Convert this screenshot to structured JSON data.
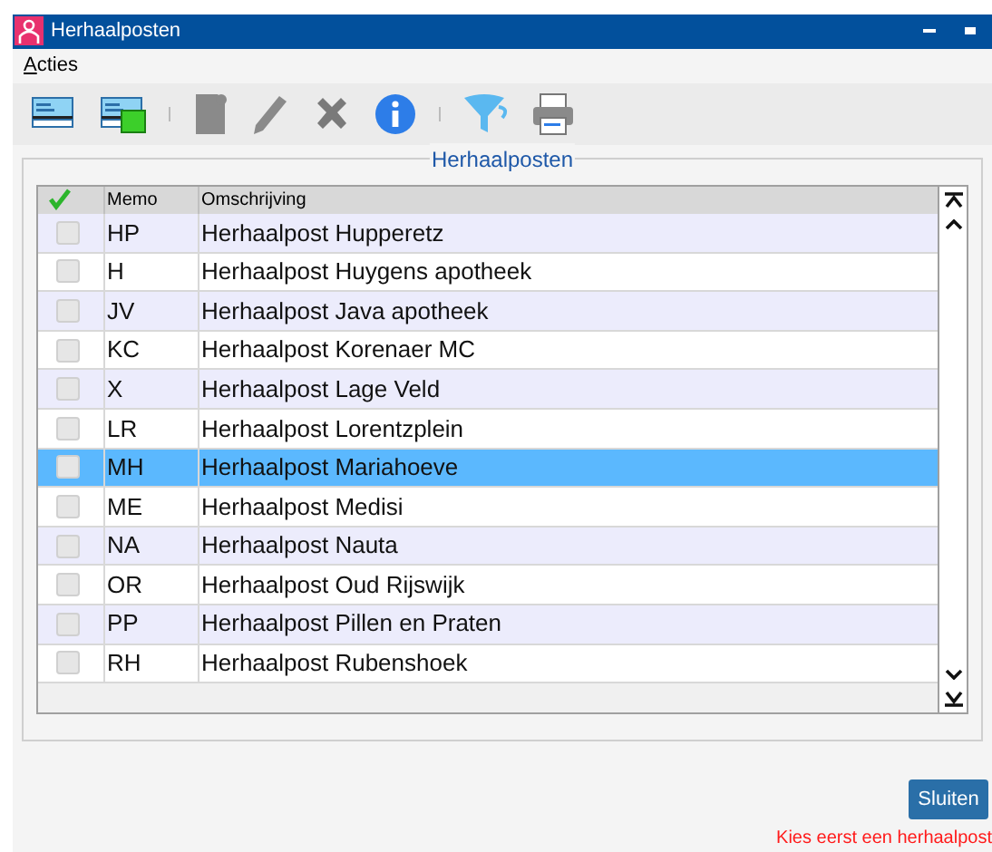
{
  "window": {
    "title": "Herhaalposten"
  },
  "menu": [
    {
      "label": "Acties"
    }
  ],
  "group": {
    "title": "Herhaalposten"
  },
  "table": {
    "columns": [
      "Memo",
      "Omschrijving"
    ],
    "rows": [
      {
        "memo": "HP",
        "description": "Herhaalpost Hupperetz",
        "checked": false,
        "selected": false
      },
      {
        "memo": "H",
        "description": "Herhaalpost Huygens apotheek",
        "checked": false,
        "selected": false
      },
      {
        "memo": "JV",
        "description": "Herhaalpost Java apotheek",
        "checked": false,
        "selected": false
      },
      {
        "memo": "KC",
        "description": "Herhaalpost Korenaer MC",
        "checked": false,
        "selected": false
      },
      {
        "memo": "X",
        "description": "Herhaalpost Lage Veld",
        "checked": false,
        "selected": false
      },
      {
        "memo": "LR",
        "description": "Herhaalpost Lorentzplein",
        "checked": false,
        "selected": false
      },
      {
        "memo": "MH",
        "description": "Herhaalpost Mariahoeve",
        "checked": false,
        "selected": true
      },
      {
        "memo": "ME",
        "description": "Herhaalpost Medisi",
        "checked": false,
        "selected": false
      },
      {
        "memo": "NA",
        "description": "Herhaalpost Nauta",
        "checked": false,
        "selected": false
      },
      {
        "memo": "OR",
        "description": "Herhaalpost Oud Rijswijk",
        "checked": false,
        "selected": false
      },
      {
        "memo": "PP",
        "description": "Herhaalpost Pillen en Praten",
        "checked": false,
        "selected": false
      },
      {
        "memo": "RH",
        "description": "Herhaalpost Rubenshoek",
        "checked": false,
        "selected": false
      }
    ]
  },
  "buttons": [
    {
      "label": "Sluiten"
    }
  ],
  "error": "Kies eerst een herhaalpost"
}
